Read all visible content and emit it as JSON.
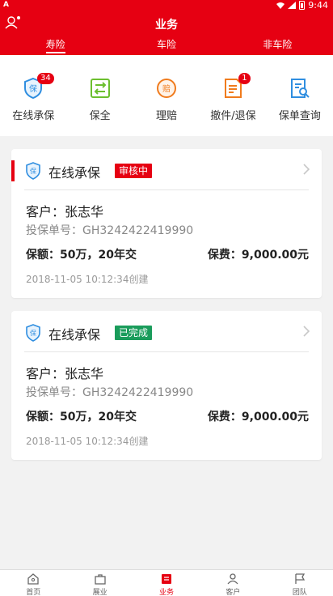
{
  "status_bar": {
    "left_glyph": "A",
    "time": "9:44"
  },
  "header": {
    "title": "业务",
    "tabs": [
      {
        "label": "寿险",
        "active": true
      },
      {
        "label": "车险",
        "active": false
      },
      {
        "label": "非车险",
        "active": false
      }
    ]
  },
  "quick_actions": [
    {
      "label": "在线承保",
      "icon": "shield-icon",
      "badge": "34"
    },
    {
      "label": "保全",
      "icon": "transfer-icon",
      "badge": ""
    },
    {
      "label": "理赔",
      "icon": "claim-icon",
      "badge": ""
    },
    {
      "label": "撤件/退保",
      "icon": "document-icon",
      "badge": "1"
    },
    {
      "label": "保单查询",
      "icon": "search-document-icon",
      "badge": ""
    }
  ],
  "cards": [
    {
      "title": "在线承保",
      "status": "审核中",
      "status_color": "#e60012",
      "customer": "客户：张志华",
      "policy_no": "投保单号：GH3242422419990",
      "coverage": "保额：50万，20年交",
      "premium": "保费：9,000.00元",
      "created": "2018-11-05 10:12:34创建"
    },
    {
      "title": "在线承保",
      "status": "已完成",
      "status_color": "#1a9c5b",
      "customer": "客户：张志华",
      "policy_no": "投保单号：GH3242422419990",
      "coverage": "保额：50万，20年交",
      "premium": "保费：9,000.00元",
      "created": "2018-11-05 10:12:34创建"
    }
  ],
  "bottom_nav": [
    {
      "label": "首页",
      "icon": "home-icon"
    },
    {
      "label": "展业",
      "icon": "briefcase-icon"
    },
    {
      "label": "业务",
      "icon": "business-icon",
      "active": true
    },
    {
      "label": "客户",
      "icon": "customer-icon"
    },
    {
      "label": "团队",
      "icon": "team-flag-icon"
    }
  ],
  "colors": {
    "brand": "#e60012",
    "pending": "#e60012",
    "done": "#1a9c5b",
    "icon_blue": "#2f8ee0",
    "icon_green": "#6cbf2f",
    "icon_orange": "#f07b1d"
  }
}
